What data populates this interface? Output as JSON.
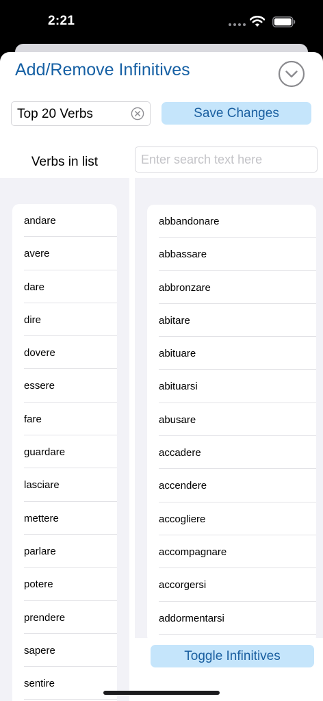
{
  "status_bar": {
    "time": "2:21"
  },
  "sheet": {
    "title": "Add/Remove Infinitives",
    "list_name_value": "Top 20 Verbs",
    "save_label": "Save Changes",
    "left_header": "Verbs in list",
    "search_placeholder": "Enter search text here",
    "toggle_label": "Toggle Infinitives"
  },
  "left_items": [
    "andare",
    "avere",
    "dare",
    "dire",
    "dovere",
    "essere",
    "fare",
    "guardare",
    "lasciare",
    "mettere",
    "parlare",
    "potere",
    "prendere",
    "sapere",
    "sentire"
  ],
  "right_items": [
    "abbandonare",
    "abbassare",
    "abbronzare",
    "abitare",
    "abituare",
    "abituarsi",
    "abusare",
    "accadere",
    "accendere",
    "accogliere",
    "accompagnare",
    "accorgersi",
    "addormentarsi"
  ],
  "colors": {
    "accent": "#1660a4",
    "button_fill": "#c5e5fb",
    "pane_background": "#f2f2f7"
  },
  "icons": {
    "dismiss": "chevron-down-circle-icon",
    "clear": "x-circle-icon",
    "wifi": "wifi-icon",
    "battery": "battery-icon"
  }
}
